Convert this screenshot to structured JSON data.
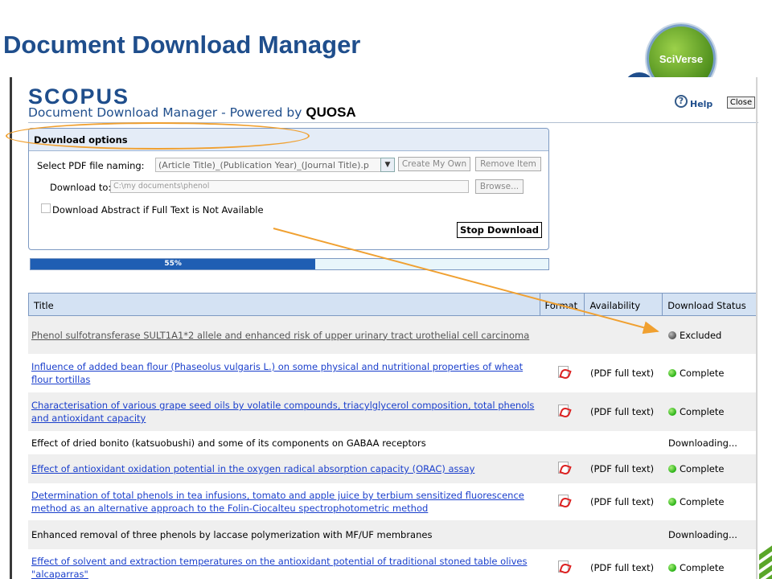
{
  "slide": {
    "title": "Document Download Manager",
    "badge_text": "SciVerse"
  },
  "app": {
    "logo": "SCOPUS",
    "subtitle": "Document Download Manager - Powered by",
    "subtitle_brand": "QUOSA",
    "help_label": "Help",
    "close_label": "Close"
  },
  "options": {
    "header": "Download options",
    "naming_label": "Select PDF file naming:",
    "naming_value": "(Article Title)_(Publication Year)_(Journal Title).p",
    "create_label": "Create My Own",
    "remove_label": "Remove Item",
    "download_to_label": "Download to:",
    "download_to_value": "C:\\my documents\\phenol",
    "browse_label": "Browse...",
    "abstract_label": "Download Abstract if Full Text is Not Available",
    "abstract_checked": false,
    "stop_label": "Stop Download"
  },
  "progress": {
    "value": 0.55,
    "label": "55%",
    "fill_color": "#1f5eb3"
  },
  "grid": {
    "columns": [
      "Title",
      "Format",
      "Availability",
      "Download Status"
    ],
    "rows": [
      {
        "title": "Phenol sulfotransferase SULT1A1*2 allele and enhanced risk of upper urinary tract urothelial cell carcinoma",
        "format": "",
        "availability": "",
        "status": "Excluded"
      },
      {
        "title": "Influence of added bean flour (Phaseolus vulgaris L.) on some physical and nutritional properties of wheat flour tortillas",
        "format": "pdf-icon",
        "availability": "(PDF full text)",
        "status": "Complete"
      },
      {
        "title": "Characterisation of various grape seed oils by volatile compounds, triacylglycerol composition, total phenols and antioxidant capacity",
        "format": "pdf-icon",
        "availability": "(PDF full text)",
        "status": "Complete"
      },
      {
        "title": "Effect of dried bonito (katsuobushi) and some of its components on GABAA receptors",
        "format": "",
        "availability": "",
        "status": "Downloading..."
      },
      {
        "title": "Effect of antioxidant oxidation potential in the oxygen radical absorption capacity (ORAC) assay",
        "format": "pdf-icon",
        "availability": "(PDF full text)",
        "status": "Complete"
      },
      {
        "title": "Determination of total phenols in tea infusions, tomato and apple juice by terbium sensitized fluorescence method as an alternative approach to the Folin-Ciocalteu spectrophotometric method",
        "format": "pdf-icon",
        "availability": "(PDF full text)",
        "status": "Complete"
      },
      {
        "title": "Enhanced removal of three phenols by laccase polymerization with MF/UF membranes",
        "format": "",
        "availability": "",
        "status": "Downloading..."
      },
      {
        "title": "Effect of solvent and extraction temperatures on the antioxidant potential of traditional stoned table olives \"alcaparras\"",
        "format": "pdf-icon",
        "availability": "(PDF full text)",
        "status": "Complete"
      }
    ]
  },
  "colors": {
    "accent": "#1f4e8c",
    "highlight": "#f0a030",
    "complete": "#27b014",
    "excluded": "#555555"
  }
}
